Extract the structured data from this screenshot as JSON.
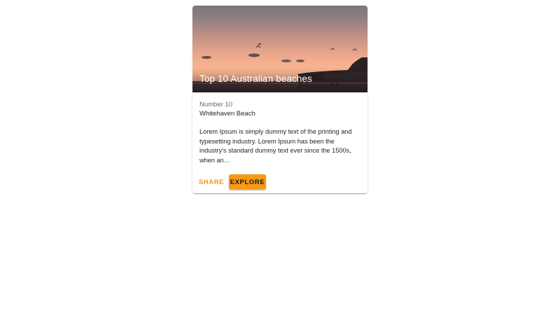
{
  "card": {
    "media": {
      "title": "Top 10 Australian beaches"
    },
    "overline": "Number 10",
    "subtitle": "Whitehaven Beach",
    "description": "Lorem Ipsum is simply dummy text of the printing and typesetting industry. Lorem Ipsum has been the industry's standard dummy text ever since the 1500s, when an…",
    "actions": {
      "share_label": "Share",
      "explore_label": "Explore"
    }
  },
  "colors": {
    "accent": "#f79a13",
    "accent_text": "#f29a12"
  }
}
